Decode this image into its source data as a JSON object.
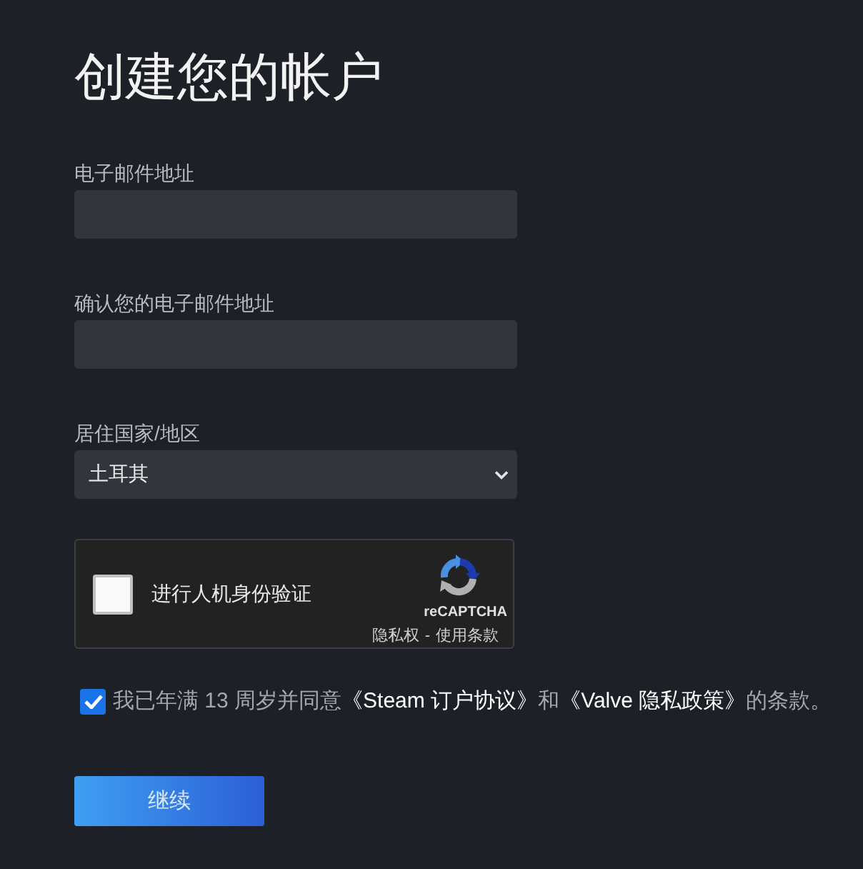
{
  "page": {
    "title": "创建您的帐户"
  },
  "fields": [
    {
      "kind": "text",
      "label": "电子邮件地址"
    },
    {
      "kind": "text",
      "label": "确认您的电子邮件地址"
    },
    {
      "kind": "select",
      "label": "居住国家/地区",
      "value": "土耳其"
    }
  ],
  "captcha": {
    "checked": false,
    "prompt": "进行人机身份验证",
    "brand": "reCAPTCHA",
    "links": [
      "隐私权",
      "使用条款"
    ],
    "separator": "-"
  },
  "agreement": {
    "checked": true,
    "parts": [
      {
        "kind": "text",
        "text": "我已年满 13 周岁并同意"
      },
      {
        "kind": "link",
        "text": "《Steam 订户协议》"
      },
      {
        "kind": "text",
        "text": "和"
      },
      {
        "kind": "link",
        "text": "《Valve 隐私政策》"
      },
      {
        "kind": "text",
        "text": "的条款。"
      }
    ]
  },
  "button": {
    "label": "继续"
  }
}
